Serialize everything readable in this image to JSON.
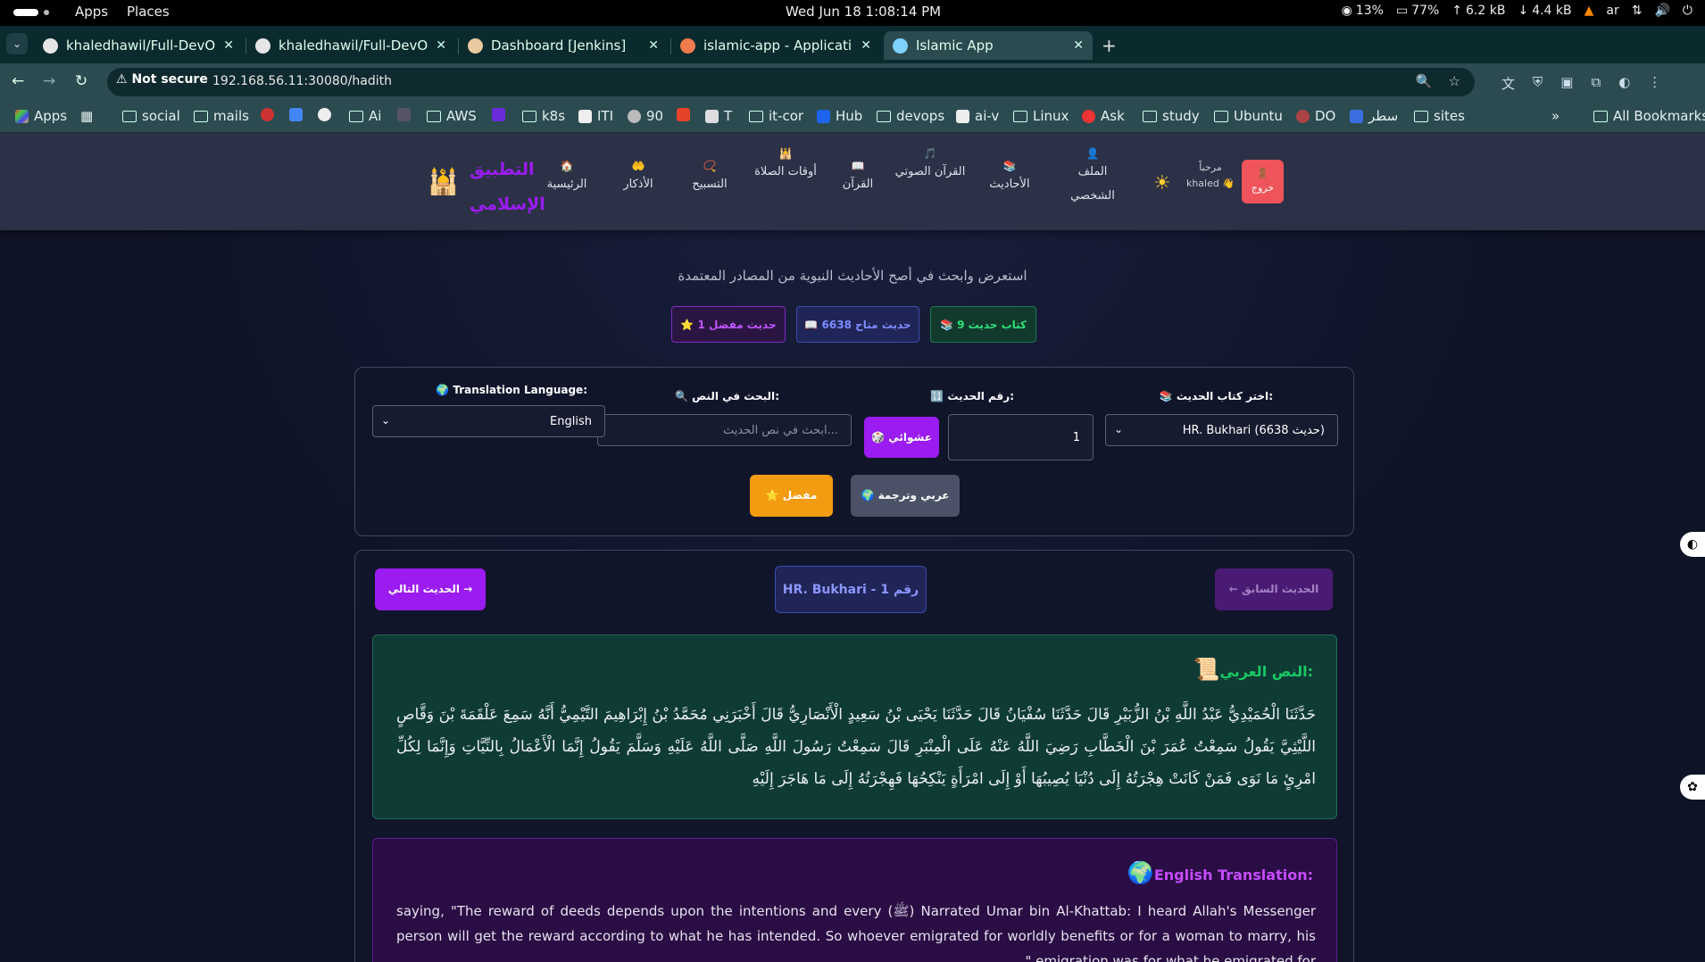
{
  "os": {
    "apps": "Apps",
    "places": "Places",
    "clock": "Wed Jun 18   1:08:14 PM",
    "cpu": "13%",
    "mem": "77%",
    "up": "6.2 kB",
    "down": "4.4 kB",
    "lang": "ar"
  },
  "tabs": [
    {
      "title": "khaledhawil/Full-DevOp"
    },
    {
      "title": "khaledhawil/Full-DevOp"
    },
    {
      "title": "Dashboard [Jenkins]"
    },
    {
      "title": "islamic-app - Application"
    },
    {
      "title": "Islamic App"
    }
  ],
  "address": {
    "security": "Not secure",
    "url": "192.168.56.11:30080/hadith"
  },
  "bookmarks": [
    "Apps",
    "social",
    "mails",
    "Ai",
    "AWS",
    "k8s",
    "ITI",
    "90",
    "T",
    "it-cor",
    "Hub",
    "devops",
    "ai-v",
    "Linux",
    "Ask",
    "study",
    "Ubuntu",
    "DO",
    "سطر",
    "sites",
    "All Bookmarks"
  ],
  "nav": {
    "brand_line1": "التطبيق",
    "brand_line2": "الإسلامي",
    "items": [
      {
        "icon": "🏠",
        "label": "الرئيسية"
      },
      {
        "icon": "🤲",
        "label": "الأذكار"
      },
      {
        "icon": "📿",
        "label": "التسبيح"
      },
      {
        "icon": "🕌",
        "label": "أوقات الصلاة"
      },
      {
        "icon": "📖",
        "label": "القرآن"
      },
      {
        "icon": "🎵",
        "label": "القرآن الصوتي"
      },
      {
        "icon": "📚",
        "label": "الأحاديث"
      },
      {
        "icon": "👤",
        "label": "الملف الشخصي"
      }
    ],
    "welcome": "مرحباً",
    "user": "khaled 👋",
    "logout_icon": "🚪",
    "logout": "خروج"
  },
  "subtitle": "استعرض وابحث في أصح الأحاديث النبوية من المصادر المعتمدة",
  "stats": {
    "books": "📚 9 كتاب حديث",
    "available": "📖 6638 حديث متاح",
    "favorites": "⭐ 1 حديث مفضل"
  },
  "search": {
    "book_label": "📚 اختر كتاب الحديث:",
    "book_value": "HR. Bukhari (6638 حديث)",
    "number_label": "🔢 رقم الحديث:",
    "number_value": "1",
    "random": "🎲 عشوائي",
    "text_label": "🔍 البحث في النص:",
    "text_placeholder": "ابحث في نص الحديث...",
    "lang_label": "🌍 Translation Language:",
    "lang_value": "English",
    "arabic_translation": "🌍 عربي وترجمة",
    "favorite": "⭐ مفضل"
  },
  "hadith": {
    "prev": "← الحديث السابق",
    "ref": "HR. Bukhari - رقم 1",
    "next": "الحديث التالي →",
    "arabic_title": "النص العربي:",
    "arabic_text": "حَدَّثَنَا الْحُمَيْدِيُّ عَبْدُ اللَّهِ بْنُ الزُّبَيْرِ قَالَ حَدَّثَنَا سُفْيَانُ قَالَ حَدَّثَنَا يَحْيَى بْنُ سَعِيدٍ الْأَنْصَارِيُّ قَالَ أَخْبَرَنِي مُحَمَّدُ بْنُ إِبْرَاهِيمَ التَّيْمِيُّ أَنَّهُ سَمِعَ عَلْقَمَةَ بْنَ وَقَّاصٍ اللَّيْثِيَّ يَقُولُ سَمِعْتُ عُمَرَ بْنَ الْخَطَّابِ رَضِيَ اللَّهُ عَنْهُ عَلَى الْمِنْبَرِ قَالَ سَمِعْتُ رَسُولَ اللَّهِ صَلَّى اللَّهُ عَلَيْهِ وَسَلَّمَ يَقُولُ إِنَّمَا الْأَعْمَالُ بِالنِّيَّاتِ وَإِنَّمَا لِكُلِّ امْرِئٍ مَا نَوَى فَمَنْ كَانَتْ هِجْرَتُهُ إِلَى دُنْيَا يُصِيبُهَا أَوْ إِلَى امْرَأَةٍ يَنْكِحُهَا فَهِجْرَتُهُ إِلَى مَا هَاجَرَ إِلَيْهِ",
    "translation_title": "English Translation:",
    "translation_text": "Narrated Umar bin Al-Khattab: I heard Allah's Messenger (ﷺ) saying, \"The reward of deeds depends upon the intentions and every person will get the reward according to what he has intended. So whoever emigrated for worldly benefits or for a woman to marry, his emigration was for what he emigrated for.\""
  },
  "colors": {
    "accent": "#9b1cf0",
    "green": "#18c964",
    "logout": "#f0545b",
    "favorite": "#f39c12"
  }
}
